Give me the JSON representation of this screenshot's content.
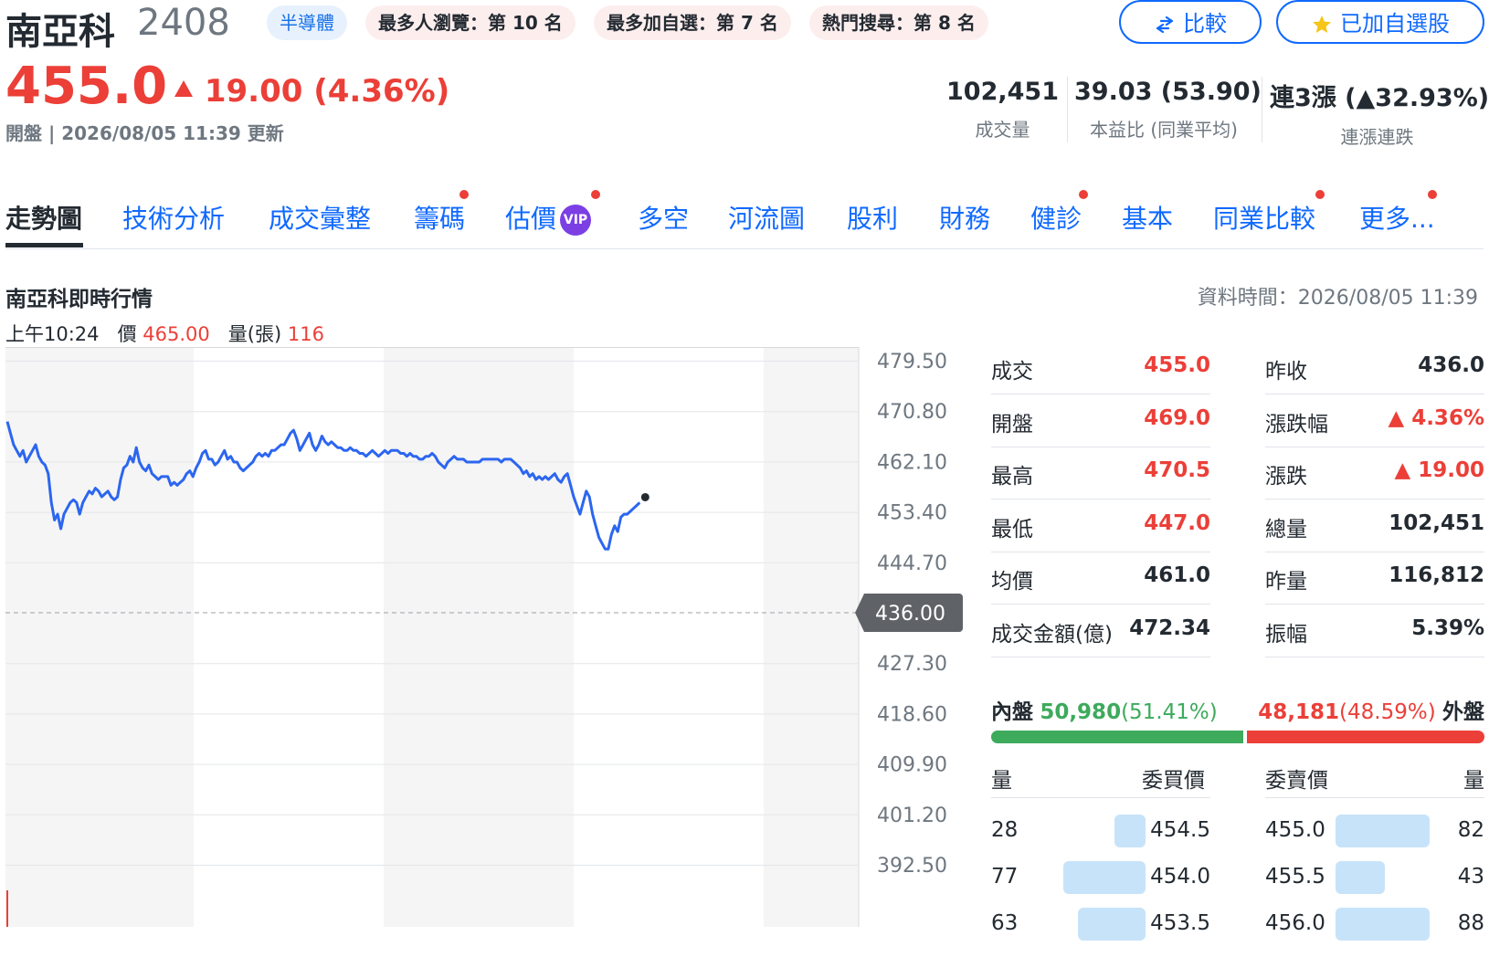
{
  "header": {
    "name": "南亞科",
    "code": "2408",
    "sector_badge": "半導體",
    "rank_badges": [
      "最多人瀏覽：第 10 名",
      "最多加自選：第 7 名",
      "熱門搜尋：第 8 名"
    ],
    "compare_label": "比較",
    "watchlist_label": "已加自選股",
    "price": "455.0",
    "change": "19.00 (4.36%)",
    "update_text": "開盤 | 2026/08/05 11:39 更新",
    "stats": [
      {
        "value": "102,451",
        "label": "成交量"
      },
      {
        "value": "39.03 (53.90)",
        "label": "本益比 (同業平均)"
      },
      {
        "value": "連3漲 (▲32.93%)",
        "label": "連漲連跌"
      }
    ]
  },
  "tabs": [
    {
      "label": "走勢圖",
      "active": true,
      "dot": false
    },
    {
      "label": "技術分析",
      "dot": false
    },
    {
      "label": "成交彙整",
      "dot": false
    },
    {
      "label": "籌碼",
      "dot": true
    },
    {
      "label": "估價",
      "dot": true,
      "vip": "VIP"
    },
    {
      "label": "多空",
      "dot": false
    },
    {
      "label": "河流圖",
      "dot": false
    },
    {
      "label": "股利",
      "dot": false
    },
    {
      "label": "財務",
      "dot": false
    },
    {
      "label": "健診",
      "dot": true
    },
    {
      "label": "基本",
      "dot": false
    },
    {
      "label": "同業比較",
      "dot": true
    },
    {
      "label": "更多...",
      "dot": true
    }
  ],
  "section": {
    "title": "南亞科即時行情",
    "data_time": "資料時間：2026/08/05 11:39",
    "hover_time": "上午10:24",
    "hover_price_label": "價",
    "hover_price": "465.00",
    "hover_vol_label": "量(張)",
    "hover_vol": "116"
  },
  "chart_data": {
    "type": "line",
    "y_ticks": [
      "479.50",
      "470.80",
      "462.10",
      "453.40",
      "444.70",
      "436.00",
      "427.30",
      "418.60",
      "409.90",
      "401.20",
      "392.50"
    ],
    "ylim": [
      392.5,
      479.5
    ],
    "reference": 436.0,
    "reference_label": "436.00",
    "line_color": "#2c66f0",
    "x": [
      0,
      1,
      2,
      3,
      4,
      5,
      6,
      7,
      8,
      9,
      10,
      11,
      12,
      13,
      14,
      15,
      16,
      17,
      18,
      19,
      20,
      21,
      22,
      23,
      24,
      25,
      26,
      27,
      28,
      29,
      30,
      31,
      32,
      33,
      34,
      35,
      36,
      37,
      38,
      39,
      40,
      41,
      42,
      43,
      44,
      45,
      46,
      47,
      48,
      49,
      50,
      51,
      52,
      53,
      54,
      55,
      56,
      57,
      58,
      59,
      60,
      61,
      62,
      63,
      64,
      65,
      66,
      67,
      68,
      69,
      70,
      71,
      72,
      73,
      74,
      75,
      76,
      77,
      78,
      79,
      80,
      81,
      82,
      83,
      84,
      85,
      86,
      87,
      88,
      89,
      90,
      91,
      92,
      93,
      94,
      95,
      96,
      97,
      98,
      99,
      100,
      101,
      102,
      103,
      104,
      105,
      106,
      107,
      108,
      109,
      110,
      111,
      112,
      113,
      114,
      115,
      116,
      117,
      118,
      119,
      120,
      121,
      122,
      123,
      124,
      125,
      126,
      127,
      128,
      129,
      130,
      131,
      132,
      133,
      134,
      135,
      136,
      137,
      138,
      139,
      140,
      141,
      142,
      143,
      144,
      145,
      146,
      147,
      148,
      149,
      150,
      151,
      152,
      153,
      154,
      155,
      156,
      157,
      158,
      159,
      160,
      161,
      162,
      163,
      164,
      165,
      166,
      167,
      168,
      169,
      170,
      171,
      172,
      173,
      174,
      175,
      176,
      177,
      178,
      179,
      180,
      181,
      182,
      183,
      184,
      185,
      186,
      187,
      188,
      189,
      190,
      191,
      192,
      193,
      194,
      195,
      196,
      197,
      198,
      199,
      200,
      201,
      202,
      203,
      204,
      205,
      206,
      207,
      208,
      209,
      210,
      211,
      212,
      213,
      214,
      215,
      216,
      217,
      218,
      219,
      220,
      221,
      222,
      223,
      224,
      225,
      226,
      227,
      228,
      229,
      230,
      231,
      232,
      233,
      234,
      235,
      236,
      237,
      238,
      239,
      240,
      241,
      242,
      243,
      244,
      245,
      246,
      247,
      248,
      249,
      250,
      251,
      252,
      253,
      254,
      255,
      256,
      257,
      258,
      259,
      260,
      261,
      262,
      263,
      264,
      265,
      266,
      267,
      268,
      269,
      270
    ],
    "values": [
      469.0,
      467.0,
      465.0,
      464.0,
      463.0,
      464.0,
      462.0,
      463.0,
      464.0,
      465.0,
      463.0,
      462.0,
      461.5,
      460.0,
      455.0,
      452.0,
      453.0,
      450.5,
      453.0,
      454.0,
      455.0,
      455.5,
      455.0,
      453.0,
      455.0,
      456.0,
      457.0,
      456.5,
      457.5,
      457.0,
      456.0,
      456.5,
      457.0,
      456.0,
      455.5,
      456.0,
      459.0,
      461.0,
      461.5,
      463.0,
      462.0,
      464.5,
      462.0,
      461.0,
      460.5,
      461.5,
      460.0,
      459.5,
      459.0,
      459.5,
      459.5,
      459.5,
      458.0,
      458.5,
      458.0,
      458.5,
      459.0,
      460.0,
      460.5,
      459.5,
      461.0,
      462.0,
      463.5,
      464.0,
      462.5,
      462.5,
      461.5,
      462.0,
      463.0,
      464.0,
      462.5,
      463.0,
      462.0,
      462.0,
      461.0,
      460.5,
      461.0,
      461.5,
      462.0,
      463.0,
      463.5,
      463.0,
      463.5,
      463.0,
      464.0,
      464.0,
      464.5,
      465.0,
      465.0,
      466.0,
      467.0,
      467.5,
      466.0,
      464.0,
      465.0,
      466.0,
      467.0,
      465.0,
      464.0,
      465.0,
      466.5,
      465.5,
      465.0,
      465.5,
      465.0,
      464.5,
      464.5,
      464.0,
      464.0,
      464.5,
      464.0,
      464.0,
      463.5,
      463.5,
      463.0,
      463.5,
      464.0,
      463.5,
      463.0,
      463.5,
      464.0,
      463.5,
      464.0,
      464.0,
      464.0,
      463.5,
      463.5,
      463.0,
      463.5,
      463.0,
      463.0,
      462.5,
      462.5,
      463.0,
      463.0,
      463.5,
      463.0,
      462.0,
      461.5,
      461.0,
      462.0,
      462.5,
      463.0,
      462.5,
      462.5,
      462.5,
      462.0,
      462.0,
      462.0,
      462.0,
      462.0,
      462.5,
      462.5,
      462.5,
      462.5,
      462.5,
      462.5,
      462.0,
      462.5,
      462.5,
      462.5,
      462.0,
      461.5,
      461.0,
      460.0,
      460.5,
      459.5,
      460.0,
      459.0,
      459.5,
      459.0,
      459.5,
      459.0,
      459.5,
      460.0,
      459.0,
      458.5,
      459.5,
      460.0,
      458.0,
      456.0,
      454.5,
      453.0,
      455.0,
      457.0,
      456.0,
      453.0,
      451.0,
      449.0,
      448.0,
      447.0,
      447.0,
      449.5,
      451.0,
      450.0,
      452.5,
      453.0,
      453.0,
      453.5,
      454.0,
      454.5,
      455.0
    ],
    "current_price": 455.0
  },
  "quote": {
    "left": [
      {
        "label": "成交",
        "value": "455.0",
        "color": "red"
      },
      {
        "label": "開盤",
        "value": "469.0",
        "color": "red"
      },
      {
        "label": "最高",
        "value": "470.5",
        "color": "red"
      },
      {
        "label": "最低",
        "value": "447.0",
        "color": "red"
      },
      {
        "label": "均價",
        "value": "461.0",
        "color": "black"
      },
      {
        "label": "成交金額(億)",
        "value": "472.34",
        "color": "black"
      }
    ],
    "right": [
      {
        "label": "昨收",
        "value": "436.0",
        "color": "black"
      },
      {
        "label": "漲跌幅",
        "value": "▲ 4.36%",
        "color": "red"
      },
      {
        "label": "漲跌",
        "value": "▲ 19.00",
        "color": "red"
      },
      {
        "label": "總量",
        "value": "102,451",
        "color": "black"
      },
      {
        "label": "昨量",
        "value": "116,812",
        "color": "black"
      },
      {
        "label": "振幅",
        "value": "5.39%",
        "color": "black"
      }
    ]
  },
  "inout": {
    "in_label": "內盤",
    "in_value": "50,980",
    "in_pct": "(51.41%)",
    "out_value": "48,181",
    "out_pct": "(48.59%)",
    "out_label": "外盤",
    "in_fraction": 0.5141
  },
  "orderbook": {
    "headers": {
      "bid_vol": "量",
      "bid_price": "委買價",
      "ask_price": "委賣價",
      "ask_vol": "量"
    },
    "rows": [
      {
        "bid_vol": "28",
        "bid_price": "454.5",
        "bid_fill": 0.35,
        "ask_price": "455.0",
        "ask_vol": "82",
        "ask_fill": 1.0
      },
      {
        "bid_vol": "77",
        "bid_price": "454.0",
        "bid_fill": 0.94,
        "ask_price": "455.5",
        "ask_vol": "43",
        "ask_fill": 0.52
      },
      {
        "bid_vol": "63",
        "bid_price": "453.5",
        "bid_fill": 0.77,
        "ask_price": "456.0",
        "ask_vol": "88",
        "ask_fill": 1.0
      }
    ]
  },
  "colors": {
    "up": "#eb3f38",
    "down": "#3daa5c",
    "accent": "#0f69ff"
  }
}
